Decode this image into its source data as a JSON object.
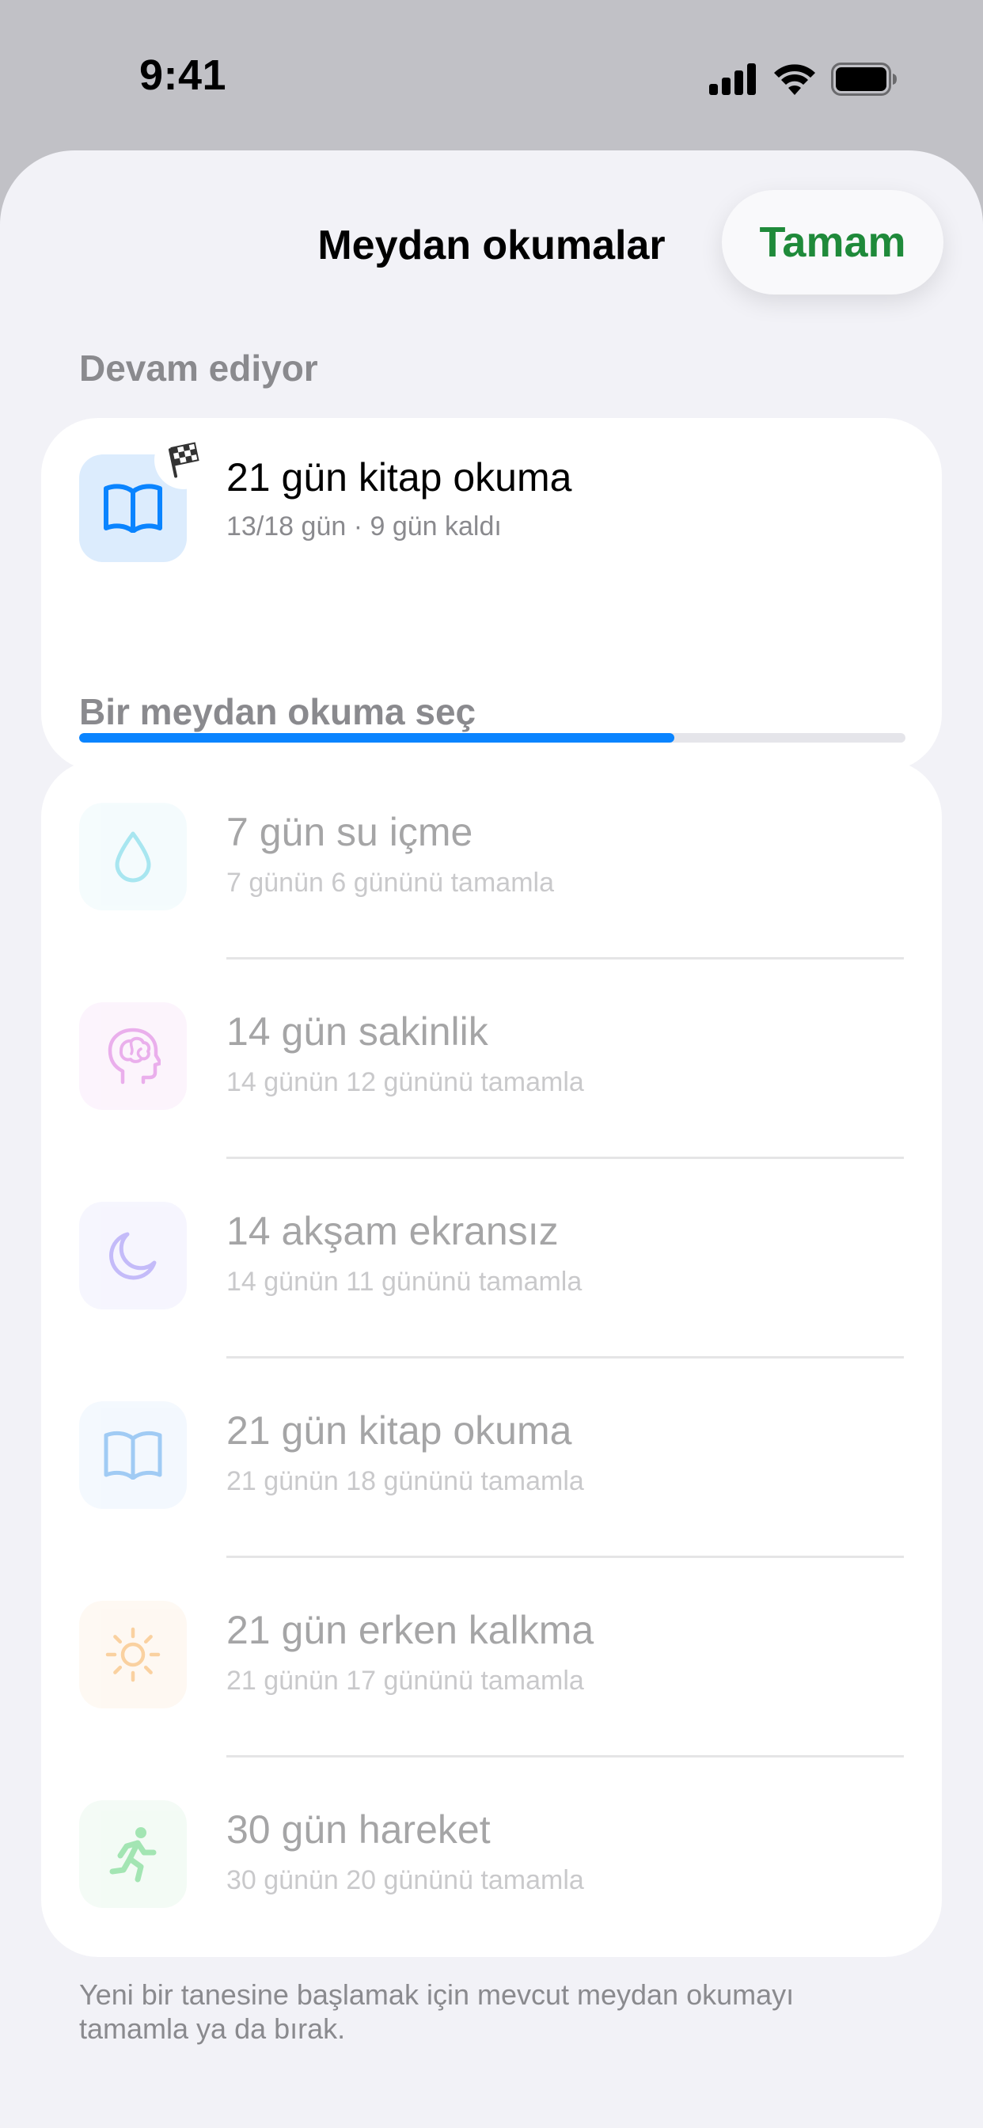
{
  "status_bar": {
    "time": "9:41"
  },
  "header": {
    "title": "Meydan okumalar",
    "done_label": "Tamam",
    "done_color": "#1f8a3a"
  },
  "in_progress": {
    "section_label": "Devam ediyor",
    "title": "21 gün kitap okuma",
    "subtitle": "13/18 gün · 9 gün kaldı",
    "progress_fraction": 0.72,
    "icon": "book-icon",
    "badge_icon": "checkered-flag-icon",
    "accent": "#0a84ff"
  },
  "choose": {
    "section_label": "Bir meydan okuma seç",
    "items": [
      {
        "title": "7 gün su içme",
        "subtitle": "7 günün 6 gününü tamamla",
        "icon": "water-drop-icon",
        "color": "#40c8e0",
        "tint": "#e8f8fb"
      },
      {
        "title": "14 gün sakinlik",
        "subtitle": "14 günün 12 gününü tamamla",
        "icon": "brain-head-icon",
        "color": "#d14fd6",
        "tint": "#f9e7fa"
      },
      {
        "title": "14 akşam ekransız",
        "subtitle": "14 günün 11 gününü tamamla",
        "icon": "moon-icon",
        "color": "#7d6bf2",
        "tint": "#ecebfd"
      },
      {
        "title": "21 gün kitap okuma",
        "subtitle": "21 günün 18 gününü tamamla",
        "icon": "book-icon",
        "color": "#2f8ee8",
        "tint": "#e6f1fd"
      },
      {
        "title": "21 gün erken kalkma",
        "subtitle": "21 günün 17 gününü tamamla",
        "icon": "sun-icon",
        "color": "#f59a2f",
        "tint": "#fdf1e4"
      },
      {
        "title": "30 gün hareket",
        "subtitle": "30 günün 20 gününü tamamla",
        "icon": "running-figure-icon",
        "color": "#34c759",
        "tint": "#e6f7ea"
      }
    ]
  },
  "footer_note": "Yeni bir tanesine başlamak için mevcut meydan okumayı tamamla ya da bırak."
}
